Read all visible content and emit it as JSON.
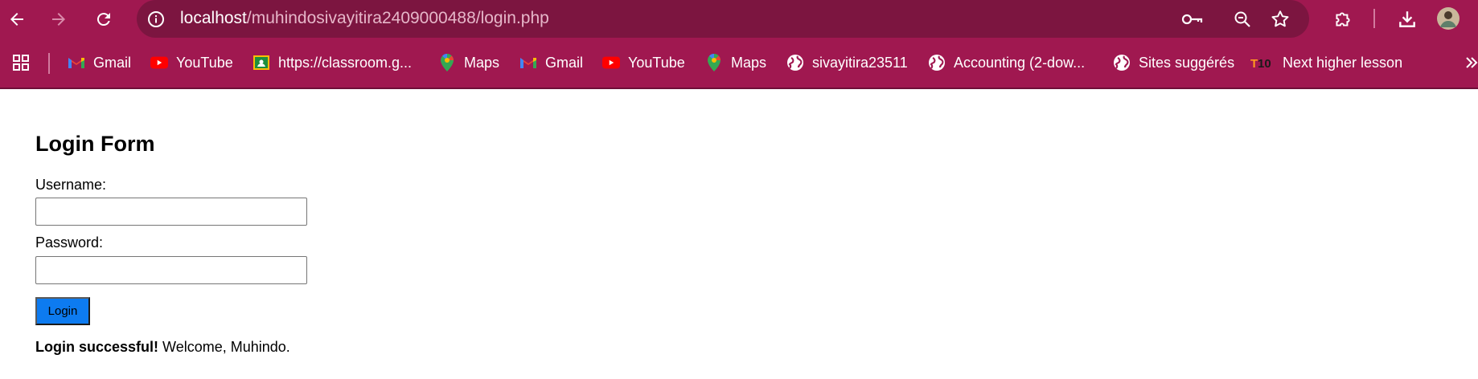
{
  "browser": {
    "url_host": "localhost",
    "url_path": "/muhindosivayitira2409000488/login.php",
    "bookmarks": [
      {
        "label": "Gmail",
        "icon": "gmail-icon"
      },
      {
        "label": "YouTube",
        "icon": "youtube-icon"
      },
      {
        "label": "https://classroom.g...",
        "icon": "classroom-icon"
      },
      {
        "label": "Maps",
        "icon": "maps-icon"
      },
      {
        "label": "Gmail",
        "icon": "gmail-icon"
      },
      {
        "label": "YouTube",
        "icon": "youtube-icon"
      },
      {
        "label": "Maps",
        "icon": "maps-icon"
      },
      {
        "label": "sivayitira23511",
        "icon": "globe-icon"
      },
      {
        "label": "Accounting (2-dow...",
        "icon": "globe-icon"
      },
      {
        "label": "Sites suggérés",
        "icon": "globe-icon"
      },
      {
        "label": "Next higher lesson",
        "icon": "t10-icon"
      }
    ],
    "colors": {
      "frame": "#a01850",
      "omnibox": "#7c1540"
    }
  },
  "form": {
    "title": "Login Form",
    "username_label": "Username:",
    "username_value": "",
    "password_label": "Password:",
    "password_value": "",
    "submit_label": "Login",
    "submit_color": "#0d7bf0"
  },
  "message": {
    "bold": "Login successful!",
    "text": " Welcome, Muhindo."
  }
}
